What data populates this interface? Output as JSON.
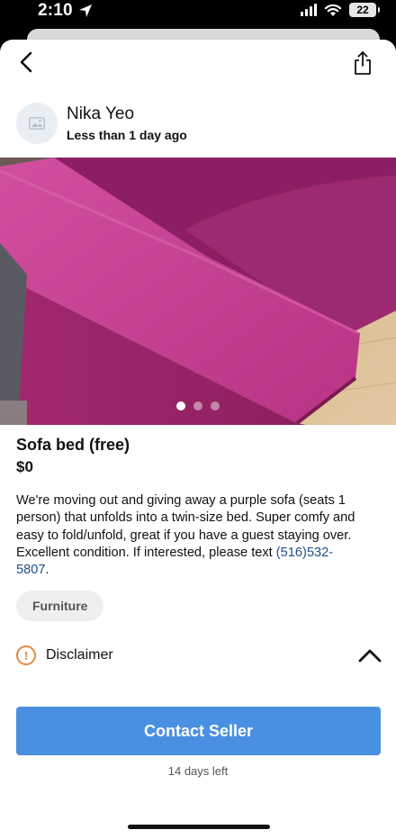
{
  "status_bar": {
    "time": "2:10",
    "battery": "22"
  },
  "seller": {
    "name": "Nika Yeo",
    "posted": "Less than 1 day ago"
  },
  "gallery": {
    "count": 3,
    "active_index": 0
  },
  "listing": {
    "title": "Sofa bed (free)",
    "price": "$0",
    "description": "We're moving out and giving away a purple sofa (seats 1 person) that unfolds into a twin-size bed. Super comfy and easy to fold/unfold, great if you have a guest staying over. Excellent condition. If interested, please text ",
    "phone": "(516)532-5807",
    "description_end": ".",
    "category": "Furniture"
  },
  "disclaimer": {
    "label": "Disclaimer",
    "icon_text": "!"
  },
  "actions": {
    "contact_label": "Contact Seller",
    "days_left": "14 days left"
  },
  "colors": {
    "accent": "#4a90e2",
    "link": "#1f4f8b",
    "warning": "#e08a3d",
    "sofa": "#b0307d"
  }
}
